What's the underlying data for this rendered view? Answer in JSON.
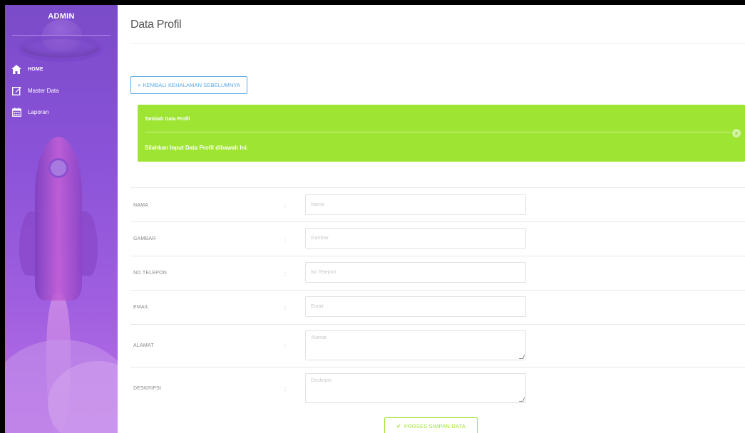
{
  "sidebar": {
    "title": "ADMIN",
    "items": [
      {
        "label": "HOME",
        "icon": "home-icon"
      },
      {
        "label": "Master Data",
        "icon": "edit-icon"
      },
      {
        "label": "Laporan",
        "icon": "calendar-icon"
      }
    ]
  },
  "page": {
    "title": "Data Profil",
    "back_button": "KEMBALI KEHALAMAN SEBELUMNYA",
    "back_icon": "double-chevron-left-icon"
  },
  "alert": {
    "title": "Tambah Data Profil",
    "message": "Silahkan Input Data Profil dibawah Ini.",
    "close_glyph": "×",
    "color": "#9de532"
  },
  "form": {
    "fields": [
      {
        "label": "NAMA",
        "placeholder": "Nama",
        "type": "input"
      },
      {
        "label": "GAMBAR",
        "placeholder": "Gambar",
        "type": "input"
      },
      {
        "label": "NO TELEPON",
        "placeholder": "No Telepon",
        "type": "input"
      },
      {
        "label": "EMAIL",
        "placeholder": "Email",
        "type": "input"
      },
      {
        "label": "ALAMAT",
        "placeholder": "Alamat",
        "type": "textarea"
      },
      {
        "label": "DESKRIPSI",
        "placeholder": "Deskripsi",
        "type": "textarea"
      }
    ],
    "colon": ":",
    "submit_label": "PROSES SIMPAN DATA",
    "submit_icon": "check-icon"
  },
  "colors": {
    "sidebar_top": "#7a4bc9",
    "sidebar_bottom": "#b86fe6",
    "accent_blue": "#5aa9e6",
    "accent_green": "#9de532"
  }
}
